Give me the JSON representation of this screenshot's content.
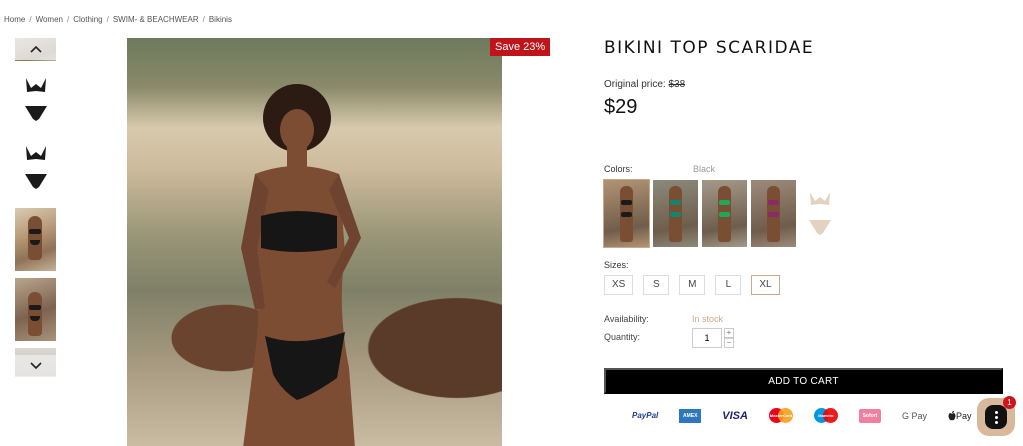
{
  "breadcrumb": [
    "Home",
    "Women",
    "Clothing",
    "SWIM- & BEACHWEAR",
    "Bikinis"
  ],
  "breadcrumb_separator": "/",
  "product": {
    "title": "BIKINI TOP SCARIDAE",
    "save_badge": "Save 23%",
    "original_price_label": "Original price:",
    "original_price": "$38",
    "price": "$29"
  },
  "colors": {
    "label": "Colors:",
    "selected": "Black",
    "options": [
      {
        "name": "Black",
        "top": "#1a1a1a",
        "bottom": "#1a1a1a",
        "bg": "#b29474"
      },
      {
        "name": "Teal",
        "top": "#16836f",
        "bottom": "#16836f",
        "bg": "#8b8a7a"
      },
      {
        "name": "Green",
        "top": "#1ea95a",
        "bottom": "#1ea95a",
        "bg": "#a49a8a"
      },
      {
        "name": "Purple",
        "top": "#8a2a6a",
        "bottom": "#8a2a6a",
        "bg": "#9d8a7a"
      }
    ]
  },
  "sizes": {
    "label": "Sizes:",
    "options": [
      "XS",
      "S",
      "M",
      "L",
      "XL"
    ],
    "selected": "XL"
  },
  "availability": {
    "label": "Availability:",
    "value": "In stock"
  },
  "quantity": {
    "label": "Quantity:",
    "value": "1",
    "plus": "+",
    "minus": "−"
  },
  "add_to_cart": "ADD TO CART",
  "payment_methods": [
    "PayPal",
    "AMEX",
    "VISA",
    "MasterCard",
    "Maestro",
    "Sofort",
    "G Pay",
    "Pay"
  ],
  "chat": {
    "badge_count": "1"
  },
  "accent_color": "#c9a98a",
  "sale_color": "#c0141b"
}
